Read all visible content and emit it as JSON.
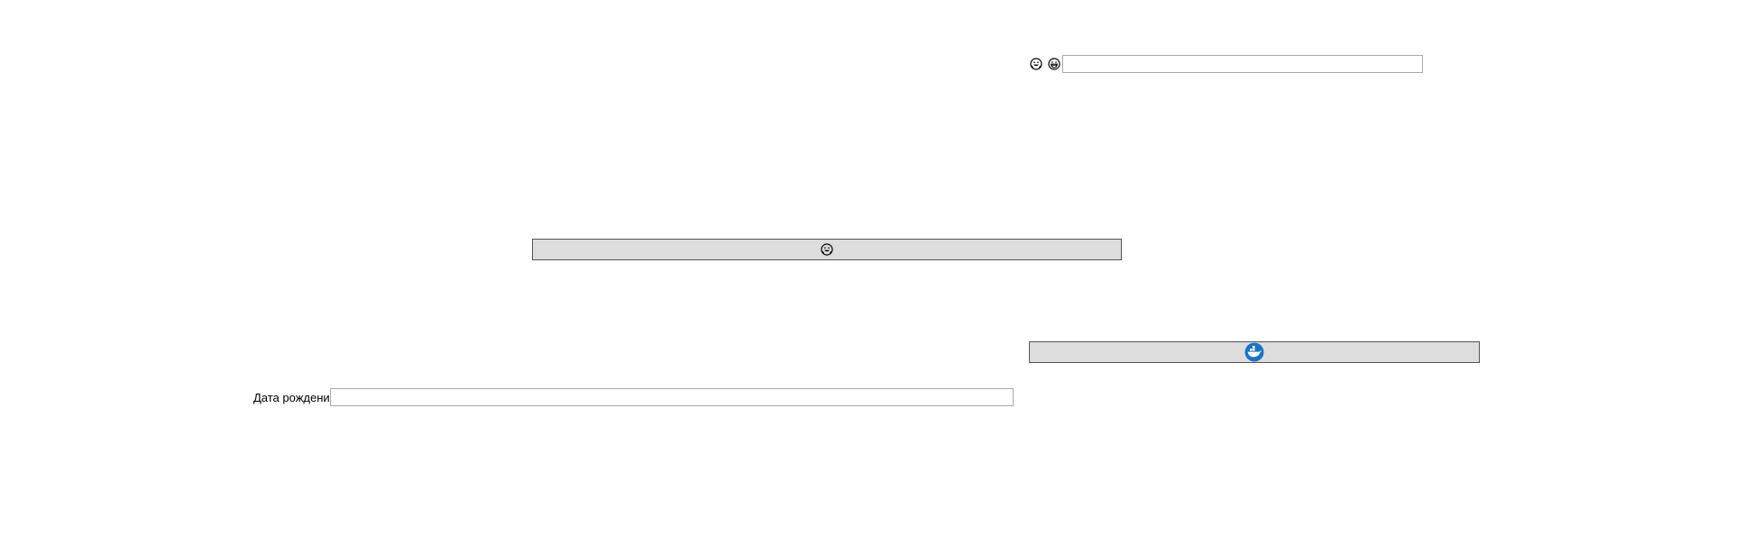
{
  "top_row": {
    "icons": [
      "grinning-face-with-hands-icon",
      "grinning-face-icon"
    ],
    "input_value": "",
    "input_placeholder": ""
  },
  "middle_button": {
    "icon": "grinning-face-with-hands-icon"
  },
  "right_button": {
    "icon": "docker-whale-icon",
    "accent_color": "#1a73c9"
  },
  "birth_date": {
    "label": "Дата рождения",
    "input_value": "",
    "input_placeholder": ""
  }
}
